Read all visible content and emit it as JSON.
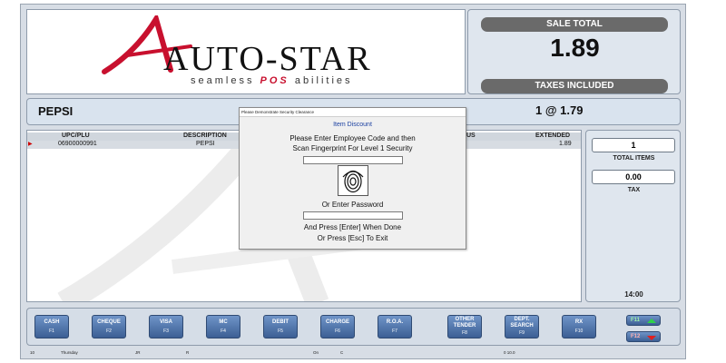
{
  "logo": {
    "brand": "AUTO-STAR",
    "tagline_left": "seamless ",
    "tagline_pos": "POS",
    "tagline_right": " abilities"
  },
  "sale": {
    "title": "SALE TOTAL",
    "amount": "1.89",
    "taxes_label": "TAXES INCLUDED"
  },
  "current_item": {
    "name": "PEPSI",
    "qty_price": "1 @  1.79"
  },
  "table": {
    "headers": {
      "upc": "UPC/PLU",
      "description": "DESCRIPTION",
      "partial_col": "US",
      "extended": "EXTENDED"
    },
    "rows": [
      {
        "upc": "06900000991",
        "description": "PEPSI",
        "extended": "1.89"
      }
    ]
  },
  "totals": {
    "total_items_value": "1",
    "total_items_label": "TOTAL ITEMS",
    "tax_value": "0.00",
    "tax_label": "TAX",
    "clock": "14:00"
  },
  "fkeys": [
    {
      "label": "CASH",
      "key": "F1"
    },
    {
      "label": "CHEQUE",
      "key": "F2"
    },
    {
      "label": "VISA",
      "key": "F3"
    },
    {
      "label": "MC",
      "key": "F4"
    },
    {
      "label": "DEBIT",
      "key": "F5"
    },
    {
      "label": "CHARGE",
      "key": "F6"
    },
    {
      "label": "R.O.A.",
      "key": "F7"
    },
    {
      "label_1": "OTHER",
      "label_2": "TENDER",
      "key": "F8"
    },
    {
      "label_1": "DEPT.",
      "label_2": "SEARCH",
      "key": "F9"
    },
    {
      "label": "RX",
      "key": "F10"
    }
  ],
  "nav_keys": {
    "f11": "F11",
    "f12": "F12"
  },
  "status_bar": {
    "s1": "10",
    "s2": "Thursday",
    "s3": "JR",
    "s4": "R",
    "s5": "On",
    "s6": "C",
    "s7": "0 10.0"
  },
  "dialog": {
    "title": "Please Demonstrate Security Clearance",
    "heading": "Item Discount",
    "line1": "Please Enter Employee Code and then",
    "line2": "Scan Fingerprint For Level 1 Security",
    "password_label": "Or Enter Password",
    "hint1": "And Press [Enter] When Done",
    "hint2": "Or Press [Esc] To Exit"
  },
  "colors": {
    "brand_red": "#c8102e",
    "key_blue": "#3c5f94",
    "dialog_heading": "#1a3fa0"
  }
}
